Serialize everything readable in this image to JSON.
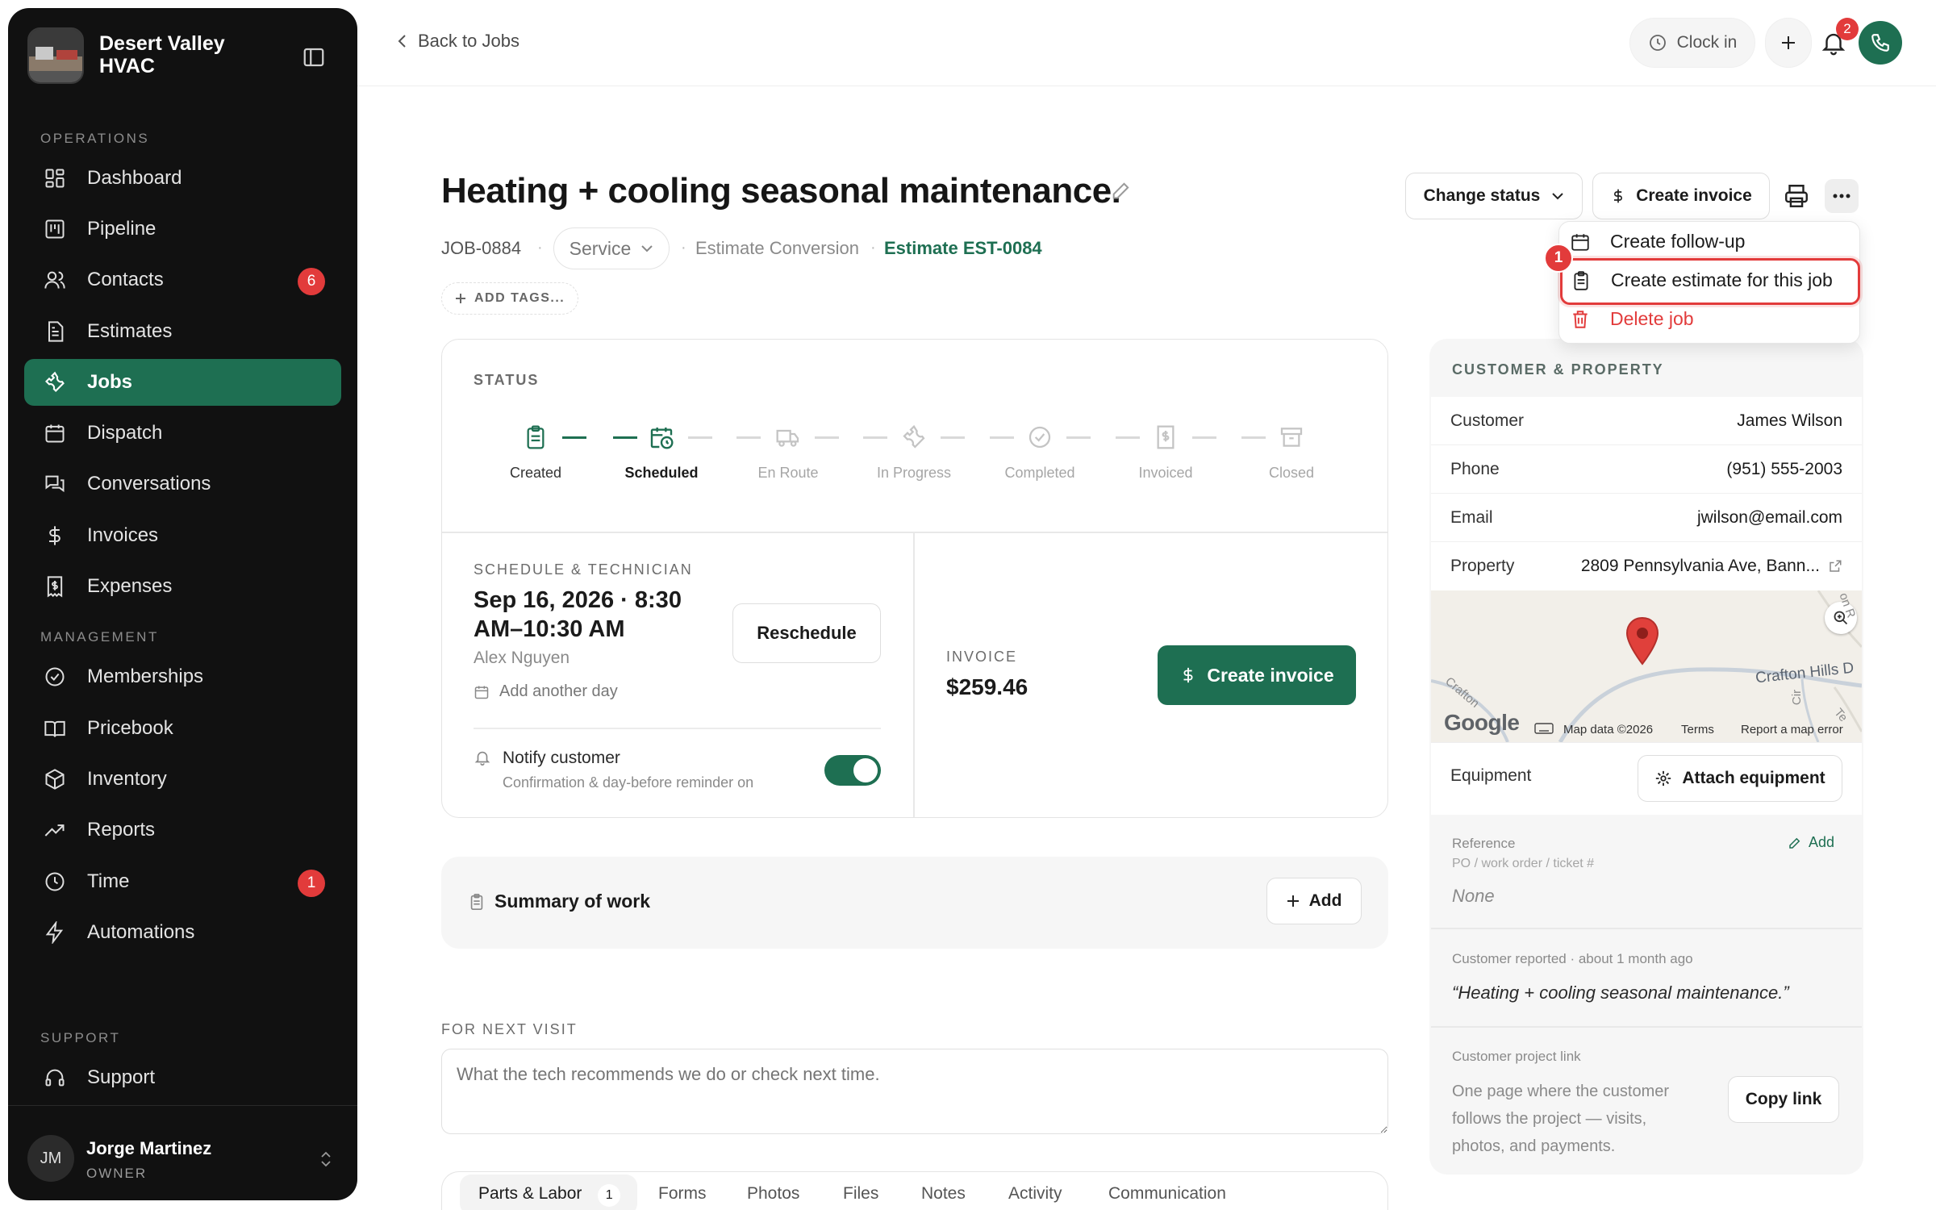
{
  "app": {
    "name": "Desert Valley HVAC"
  },
  "sidebar": {
    "sections": {
      "operations": "OPERATIONS",
      "management": "MANAGEMENT",
      "support": "SUPPORT"
    },
    "items": [
      {
        "label": "Dashboard",
        "icon": "dashboard-icon"
      },
      {
        "label": "Pipeline",
        "icon": "pipeline-icon"
      },
      {
        "label": "Contacts",
        "icon": "contacts-icon",
        "badge": "6"
      },
      {
        "label": "Estimates",
        "icon": "estimates-icon"
      },
      {
        "label": "Jobs",
        "icon": "wrench-icon",
        "active": true
      },
      {
        "label": "Dispatch",
        "icon": "calendar-icon"
      },
      {
        "label": "Conversations",
        "icon": "chat-icon"
      },
      {
        "label": "Invoices",
        "icon": "dollar-icon"
      },
      {
        "label": "Expenses",
        "icon": "receipt-icon"
      },
      {
        "label": "Memberships",
        "icon": "badge-check-icon"
      },
      {
        "label": "Pricebook",
        "icon": "book-icon"
      },
      {
        "label": "Inventory",
        "icon": "box-icon"
      },
      {
        "label": "Reports",
        "icon": "trend-icon"
      },
      {
        "label": "Time",
        "icon": "clock-icon",
        "badge": "1"
      },
      {
        "label": "Automations",
        "icon": "bolt-icon"
      },
      {
        "label": "Support",
        "icon": "headset-icon"
      }
    ],
    "user": {
      "initials": "JM",
      "name": "Jorge Martinez",
      "role": "OWNER"
    }
  },
  "topbar": {
    "back_label": "Back to Jobs",
    "clock_in_label": "Clock in",
    "notification_count": "2"
  },
  "job": {
    "title": "Heating + cooling seasonal maintenance.",
    "number": "JOB-0884",
    "type": "Service",
    "source": "Estimate Conversion",
    "estimate_link": "Estimate EST-0084",
    "add_tags": "ADD TAGS..."
  },
  "actions": {
    "change_status": "Change status",
    "create_invoice": "Create invoice"
  },
  "menu": {
    "items": [
      "Create follow-up",
      "Create estimate for this job",
      "Delete job"
    ],
    "highlight_badge": "1"
  },
  "status": {
    "label": "STATUS",
    "steps": [
      "Created",
      "Scheduled",
      "En Route",
      "In Progress",
      "Completed",
      "Invoiced",
      "Closed"
    ],
    "current_step": 1
  },
  "schedule": {
    "label": "SCHEDULE & TECHNICIAN",
    "date_line1": "Sep 16, 2026 · 8:30",
    "date_line2": "AM–10:30 AM",
    "technician": "Alex Nguyen",
    "add_day": "Add another day",
    "reschedule": "Reschedule",
    "notify_title": "Notify customer",
    "notify_sub": "Confirmation & day-before reminder on",
    "notify_on": true
  },
  "invoice": {
    "label": "INVOICE",
    "amount": "$259.46",
    "button": "Create invoice"
  },
  "summary": {
    "title": "Summary of work",
    "add": "Add"
  },
  "next_visit": {
    "label": "FOR NEXT VISIT",
    "placeholder": "What the tech recommends we do or check next time."
  },
  "tabs": [
    {
      "label": "Parts & Labor",
      "count": "1"
    },
    {
      "label": "Forms"
    },
    {
      "label": "Photos"
    },
    {
      "label": "Files"
    },
    {
      "label": "Notes"
    },
    {
      "label": "Activity"
    },
    {
      "label": "Communication"
    }
  ],
  "customer": {
    "section_label": "CUSTOMER & PROPERTY",
    "rows": [
      {
        "key": "Customer",
        "value": "James Wilson"
      },
      {
        "key": "Phone",
        "value": "(951) 555-2003"
      },
      {
        "key": "Email",
        "value": "jwilson@email.com"
      },
      {
        "key": "Property",
        "value": "2809 Pennsylvania Ave, Bann..."
      }
    ],
    "map": {
      "street_label": "Crafton Hills D",
      "street_label_left": "Crafton",
      "map_data": "Map data ©2026",
      "terms": "Terms",
      "report": "Report a map error",
      "google": "Google",
      "road_top": "on R",
      "road_vert": "Cir",
      "road_small": "Te"
    },
    "equipment_label": "Equipment",
    "attach_equipment": "Attach equipment",
    "reference_title": "Reference",
    "reference_sub": "PO / work order / ticket #",
    "reference_value": "None",
    "reference_add": "Add",
    "reported_meta": "Customer reported · about 1 month ago",
    "reported_quote": "“Heating + cooling seasonal maintenance.”",
    "project_link_title": "Customer project link",
    "project_link_desc_1": "One page where the customer",
    "project_link_desc_2": "follows the project — visits,",
    "project_link_desc_3": "photos, and payments.",
    "copy_link": "Copy link"
  },
  "colors": {
    "accent": "#1e6f52",
    "danger": "#e23b3b",
    "sidebar_bg": "#111111"
  }
}
